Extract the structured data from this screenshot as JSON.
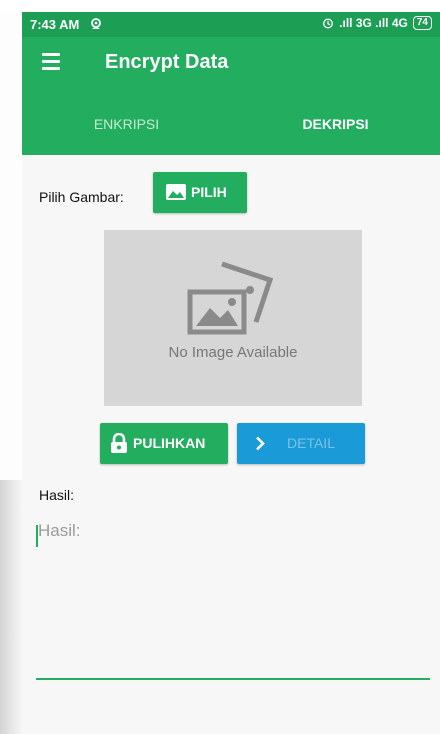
{
  "status_bar": {
    "time": "7:43 AM",
    "signal": ".ıll 3G .ıll 4G",
    "battery": "74"
  },
  "app_bar": {
    "title": "Encrypt Data",
    "menu_icon": "menu-icon"
  },
  "tabs": [
    {
      "label": "ENKRIPSI",
      "active": false
    },
    {
      "label": "DEKRIPSI",
      "active": true
    }
  ],
  "picker": {
    "label": "Pilih Gambar:",
    "button_label": "PILIH",
    "icon": "image-icon"
  },
  "preview": {
    "placeholder_text": "No Image Available",
    "icon": "image-placeholder-icon"
  },
  "actions": {
    "restore_label": "PULIHKAN",
    "restore_icon": "lock-icon",
    "detail_label": "DETAIL",
    "detail_icon": "chevron-right-icon"
  },
  "result": {
    "label": "Hasil:",
    "value": "",
    "placeholder": "Hasil:"
  },
  "colors": {
    "primary": "#22ad5f",
    "status": "#1d9e55",
    "accent_blue": "#1a9ad6",
    "background": "#f7f7f7"
  }
}
